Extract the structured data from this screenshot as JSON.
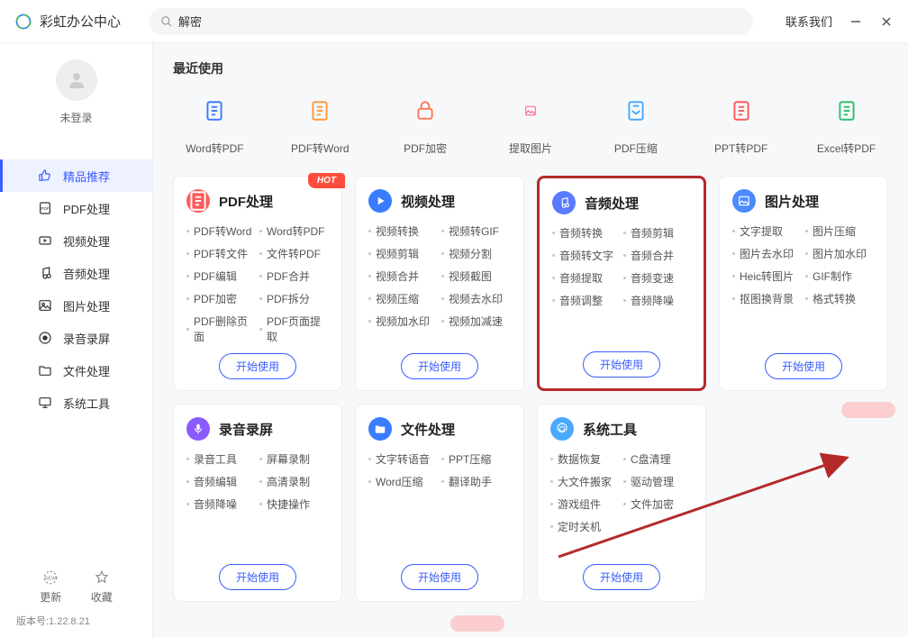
{
  "app": {
    "title": "彩虹办公中心"
  },
  "search": {
    "value": "解密"
  },
  "titlebar": {
    "contact": "联系我们"
  },
  "user": {
    "status": "未登录"
  },
  "sidebar": {
    "items": [
      {
        "label": "精品推荐",
        "icon": "thumb-up-icon"
      },
      {
        "label": "PDF处理",
        "icon": "pdf-icon"
      },
      {
        "label": "视频处理",
        "icon": "video-icon"
      },
      {
        "label": "音频处理",
        "icon": "audio-icon"
      },
      {
        "label": "图片处理",
        "icon": "image-icon"
      },
      {
        "label": "录音录屏",
        "icon": "record-icon"
      },
      {
        "label": "文件处理",
        "icon": "folder-icon"
      },
      {
        "label": "系统工具",
        "icon": "system-icon"
      }
    ],
    "bottom": {
      "update": "更新",
      "favorite": "收藏"
    },
    "version": "版本号:1.22.8.21"
  },
  "recent": {
    "title": "最近使用",
    "items": [
      {
        "label": "Word转PDF",
        "color": "#3a7cff"
      },
      {
        "label": "PDF转Word",
        "color": "#ff9a3d"
      },
      {
        "label": "PDF加密",
        "color": "#ff7a5a"
      },
      {
        "label": "提取图片",
        "color": "#ff6b8a"
      },
      {
        "label": "PDF压缩",
        "color": "#4aa8ff"
      },
      {
        "label": "PPT转PDF",
        "color": "#ff5a5a"
      },
      {
        "label": "Excel转PDF",
        "color": "#2fbf6f"
      }
    ]
  },
  "cards": [
    {
      "title": "PDF处理",
      "icon_color": "#ff5a5a",
      "hot": "HOT",
      "features": [
        "PDF转Word",
        "Word转PDF",
        "PDF转文件",
        "文件转PDF",
        "PDF编辑",
        "PDF合并",
        "PDF加密",
        "PDF拆分",
        "PDF删除页面",
        "PDF页面提取"
      ],
      "button": "开始使用"
    },
    {
      "title": "视频处理",
      "icon_color": "#3a7cff",
      "features": [
        "视频转换",
        "视频转GIF",
        "视频剪辑",
        "视频分割",
        "视频合并",
        "视频截图",
        "视频压缩",
        "视频去水印",
        "视频加水印",
        "视频加减速"
      ],
      "button": "开始使用"
    },
    {
      "title": "音频处理",
      "icon_color": "#5a7aff",
      "highlight": true,
      "features": [
        "音频转换",
        "音频剪辑",
        "音频转文字",
        "音频合并",
        "音频提取",
        "音频变速",
        "音频调整",
        "音频降噪"
      ],
      "button": "开始使用"
    },
    {
      "title": "图片处理",
      "icon_color": "#4a8aff",
      "features": [
        "文字提取",
        "图片压缩",
        "图片去水印",
        "图片加水印",
        "Heic转图片",
        "GIF制作",
        "抠图换背景",
        "格式转换"
      ],
      "button": "开始使用"
    },
    {
      "title": "录音录屏",
      "icon_color": "#8a5aff",
      "features": [
        "录音工具",
        "屏幕录制",
        "音频编辑",
        "高清录制",
        "音频降噪",
        "快捷操作"
      ],
      "button": "开始使用"
    },
    {
      "title": "文件处理",
      "icon_color": "#3a7cff",
      "features": [
        "文字转语音",
        "PPT压缩",
        "Word压缩",
        "翻译助手"
      ],
      "button": "开始使用"
    },
    {
      "title": "系统工具",
      "icon_color": "#4aa8ff",
      "features": [
        "数据恢复",
        "C盘清理",
        "大文件搬家",
        "驱动管理",
        "游戏组件",
        "文件加密",
        "定时关机"
      ],
      "button": "开始使用"
    }
  ]
}
